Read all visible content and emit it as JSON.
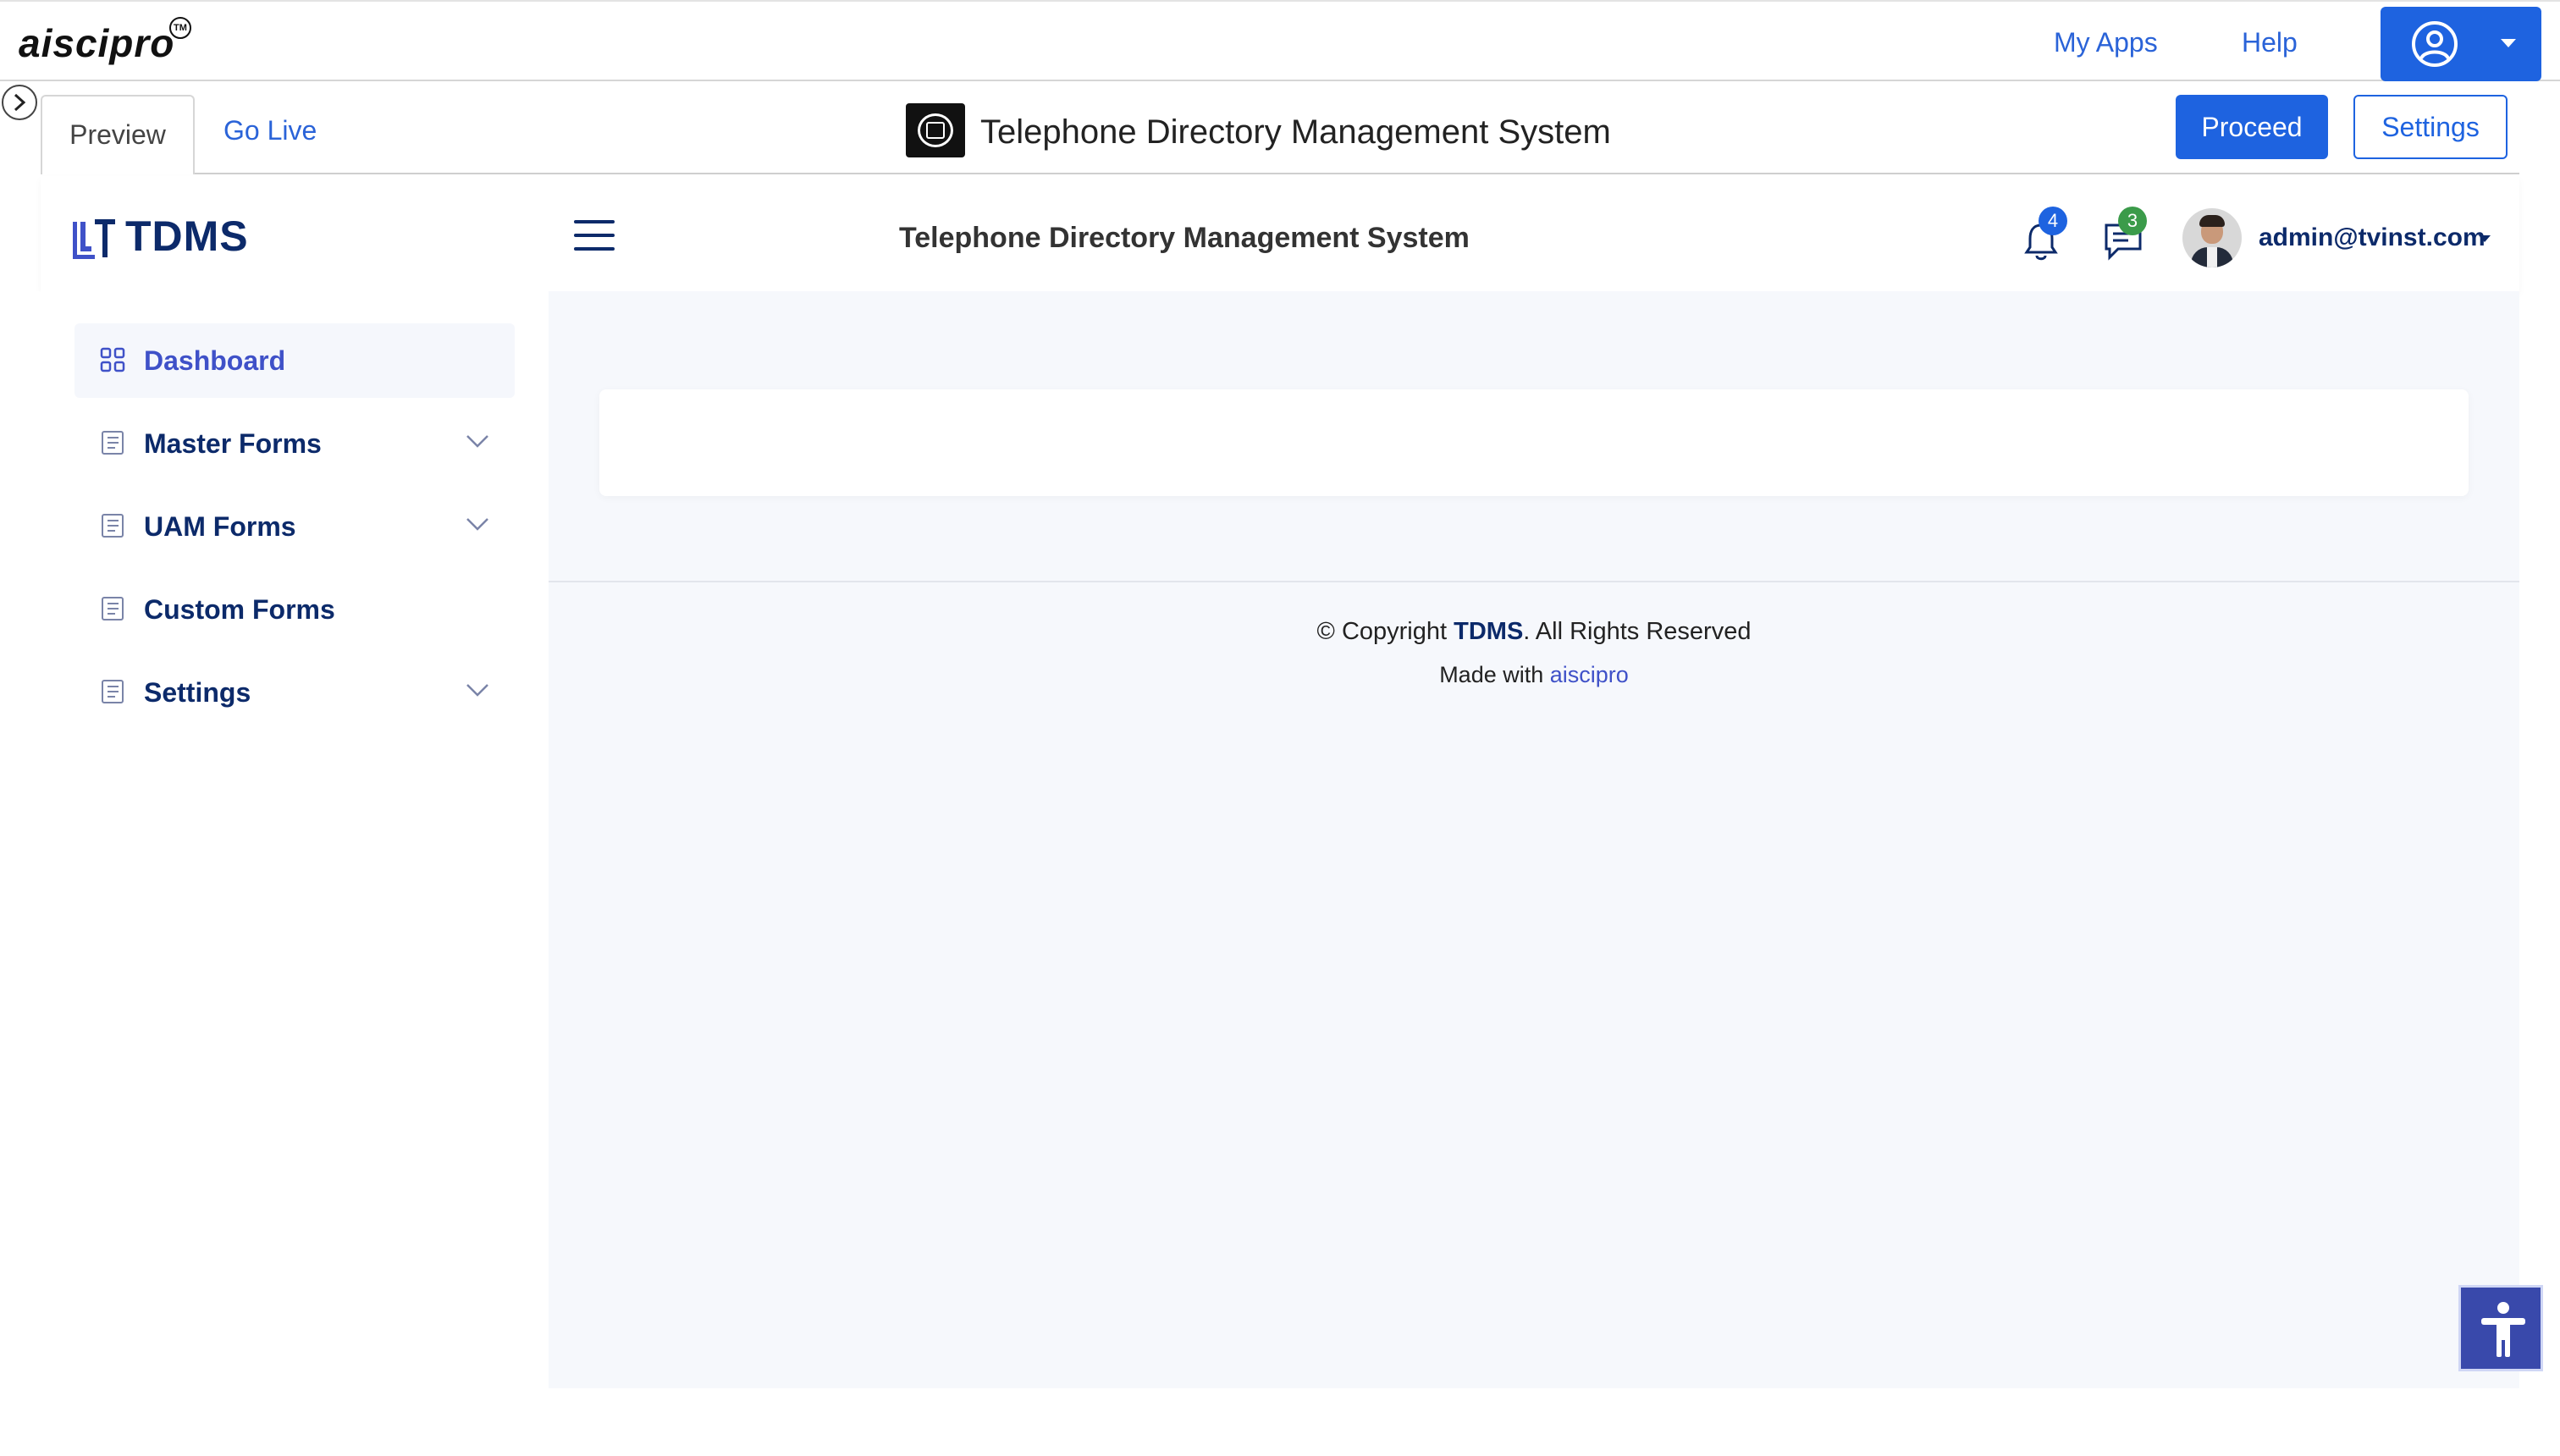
{
  "platform": {
    "brand": "aiscipro",
    "brand_mark": "TM",
    "links": {
      "my_apps": "My Apps",
      "help": "Help"
    },
    "user_icon": "user-circle-icon"
  },
  "preview_bar": {
    "tabs": [
      "Preview",
      "Go Live"
    ],
    "app_title": "Telephone Directory Management System",
    "proceed_label": "Proceed",
    "settings_label": "Settings"
  },
  "app_header": {
    "logo_text": "TDMS",
    "title": "Telephone Directory Management System",
    "notifications_count": "4",
    "messages_count": "3",
    "user_email": "admin@tvinst.com"
  },
  "sidebar": {
    "items": [
      {
        "label": "Dashboard",
        "icon": "grid-icon",
        "active": true,
        "expandable": false
      },
      {
        "label": "Master Forms",
        "icon": "form-icon",
        "active": false,
        "expandable": true
      },
      {
        "label": "UAM Forms",
        "icon": "form-icon",
        "active": false,
        "expandable": true
      },
      {
        "label": "Custom Forms",
        "icon": "form-icon",
        "active": false,
        "expandable": false
      },
      {
        "label": "Settings",
        "icon": "form-icon",
        "active": false,
        "expandable": true
      }
    ]
  },
  "footer": {
    "copyright_prefix": "© Copyright",
    "copyright_brand": "TDMS",
    "copyright_suffix": ". All Rights Reserved",
    "made_with": "Made with",
    "made_with_link": "aiscipro"
  },
  "colors": {
    "primary": "#1e63e0",
    "navy": "#0c2a6a",
    "active_accent": "#3f51c8",
    "badge_green": "#3b9b4a",
    "accessibility": "#3949ab"
  }
}
